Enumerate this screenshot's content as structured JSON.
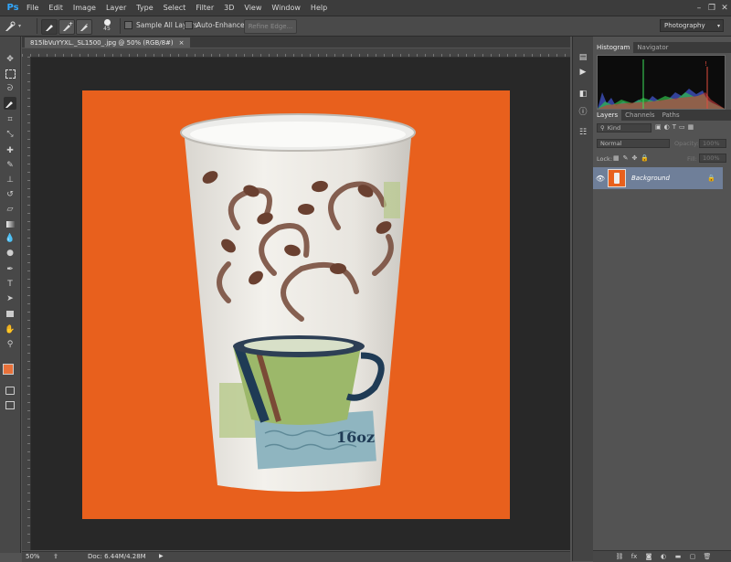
{
  "app": {
    "logo": "Ps",
    "accent": "#31a8ff"
  },
  "menu": [
    "File",
    "Edit",
    "Image",
    "Layer",
    "Type",
    "Select",
    "Filter",
    "3D",
    "View",
    "Window",
    "Help"
  ],
  "window_controls": {
    "minimize": "–",
    "restore": "❐",
    "close": "✕"
  },
  "options_bar": {
    "brush_size": "45",
    "sample_all_layers": "Sample All Layers",
    "auto_enhance": "Auto-Enhance",
    "refine_edge": "Refine Edge...",
    "workspace": "Photography"
  },
  "document": {
    "tab_title": "815lbVuYYXL._SL1500_.jpg @ 50% (RGB/8#)",
    "close": "×",
    "canvas_color": "#e8601d"
  },
  "image_content": {
    "cup_size_label": "16oz"
  },
  "status_bar": {
    "zoom": "50%",
    "doc_info": "Doc: 6.44M/4.28M"
  },
  "panels": {
    "top_tabs": [
      "Histogram",
      "Navigator"
    ],
    "layers_tabs": [
      "Layers",
      "Channels",
      "Paths"
    ],
    "kind_filter": "Kind",
    "blend_mode": "Normal",
    "opacity_label": "Opacity:",
    "opacity_value": "100%",
    "lock_label": "Lock:",
    "fill_label": "Fill:",
    "fill_value": "100%",
    "layer_name": "Background",
    "selected_layer_color": "#6f7f99"
  }
}
